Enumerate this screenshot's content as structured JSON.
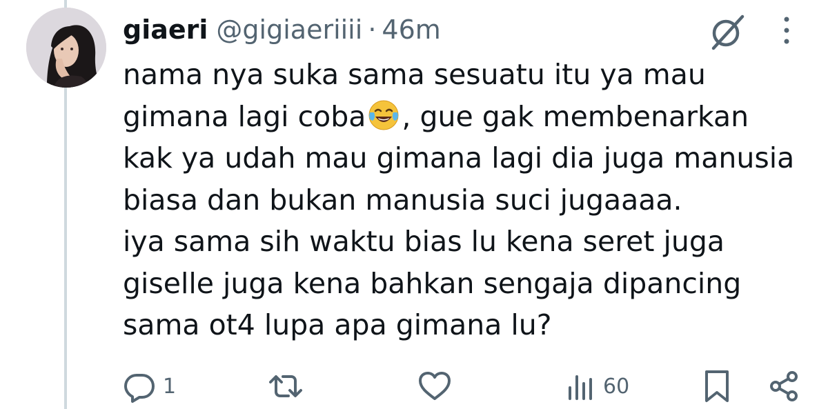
{
  "tweet": {
    "display_name": "giaeri",
    "handle": "@gigiaeriiii",
    "separator": "·",
    "time": "46m",
    "text_lines": [
      "nama nya suka sama sesuatu itu ya mau",
      "gimana lagi coba",
      ", gue gak membenarkan",
      "kak ya udah mau gimana lagi dia juga manusia",
      "biasa dan bukan manusia suci jugaaaa.",
      "iya sama sih waktu bias lu kena seret juga",
      "giselle juga kena bahkan sengaja dipancing",
      "sama ot4 lupa apa gimana lu?"
    ],
    "emoji": "face-with-tears-of-joy"
  },
  "actions": {
    "reply_count": "1",
    "repost_count": "",
    "like_count": "",
    "views_count": "60"
  },
  "icons": {
    "reply": "reply-icon",
    "repost": "repost-icon",
    "like": "like-icon",
    "views": "views-icon",
    "bookmark": "bookmark-icon",
    "share": "share-icon",
    "grok": "grok-icon",
    "more": "more-icon"
  },
  "colors": {
    "text": "#0f1419",
    "secondary": "#536471",
    "thread_line": "#cfd9de"
  }
}
